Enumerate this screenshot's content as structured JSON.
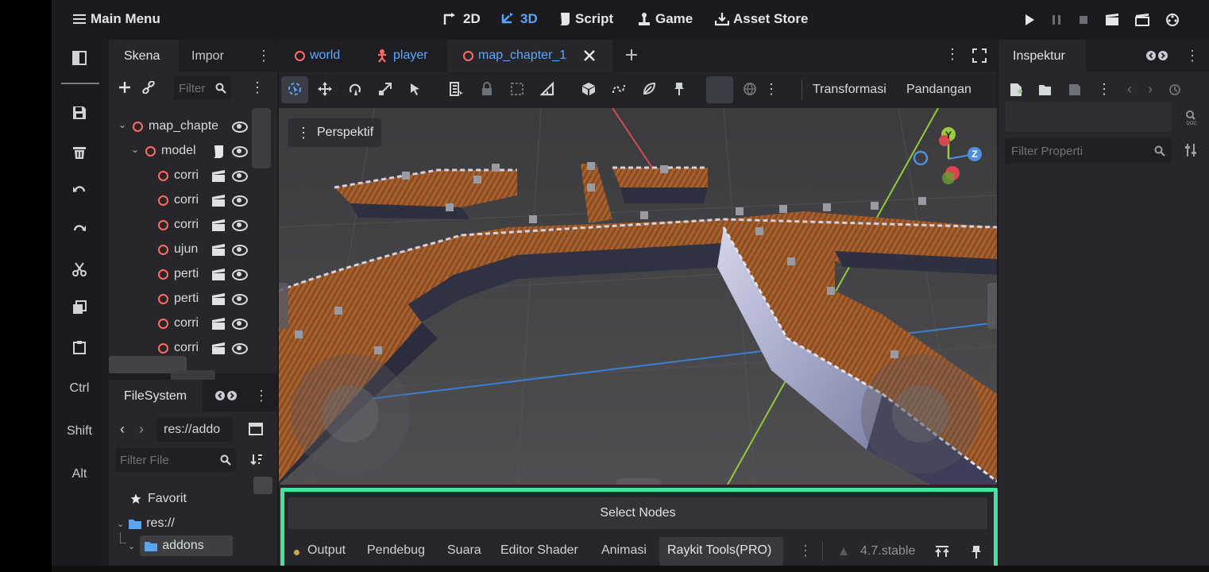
{
  "topbar": {
    "main_menu": "Main Menu",
    "modes": [
      {
        "label": "2D",
        "icon": "2d-icon"
      },
      {
        "label": "3D",
        "icon": "3d-icon",
        "active": true
      },
      {
        "label": "Script",
        "icon": "script-icon"
      },
      {
        "label": "Game",
        "icon": "game-icon"
      },
      {
        "label": "Asset Store",
        "icon": "download-icon"
      }
    ],
    "accent": "#58a5ff"
  },
  "scene_dock": {
    "tabs": [
      "Skena",
      "Impor"
    ],
    "filter_placeholder": "Filter",
    "tree": [
      {
        "label": "map_chapte",
        "depth": 0,
        "expanded": true,
        "type": "node3d"
      },
      {
        "label": "model",
        "depth": 1,
        "expanded": true,
        "type": "node3d"
      },
      {
        "label": "corri",
        "depth": 2,
        "type": "node3d"
      },
      {
        "label": "corri",
        "depth": 2,
        "type": "node3d"
      },
      {
        "label": "corri",
        "depth": 2,
        "type": "node3d"
      },
      {
        "label": "ujun",
        "depth": 2,
        "type": "node3d"
      },
      {
        "label": "perti",
        "depth": 2,
        "type": "node3d"
      },
      {
        "label": "perti",
        "depth": 2,
        "type": "node3d"
      },
      {
        "label": "corri",
        "depth": 2,
        "type": "node3d"
      },
      {
        "label": "corri",
        "depth": 2,
        "type": "node3d"
      }
    ]
  },
  "filesystem_dock": {
    "title": "FileSystem",
    "path": "res://addo",
    "filter_placeholder": "Filter File",
    "items": [
      {
        "label": "Favorit",
        "icon": "star-icon"
      },
      {
        "label": "res://",
        "icon": "folder-icon"
      },
      {
        "label": "addons",
        "icon": "folder-icon",
        "selected": true
      }
    ]
  },
  "toolstrip": {
    "modifiers": [
      "Ctrl",
      "Shift",
      "Alt"
    ]
  },
  "scene_tabs": [
    {
      "label": "world",
      "icon": "node3d-icon"
    },
    {
      "label": "player",
      "icon": "character-icon"
    },
    {
      "label": "map_chapter_1",
      "icon": "node3d-icon",
      "active": true
    }
  ],
  "viewport_toolbar": {
    "transform_label": "Transformasi",
    "view_label": "Pandangan",
    "perspective_label": "Perspektif",
    "gizmo_axes": [
      "Y",
      "Z"
    ]
  },
  "inspector": {
    "title": "Inspektur",
    "filter_placeholder": "Filter Properti"
  },
  "bottom_panel": {
    "select_nodes": "Select Nodes",
    "tabs": [
      "Output",
      "Pendebug",
      "Suara",
      "Editor Shader",
      "Animasi",
      "Raykit Tools(PRO)"
    ],
    "active_tab": "Raykit Tools(PRO)",
    "version": "4.7.stable",
    "highlight": "#3fe59a"
  }
}
